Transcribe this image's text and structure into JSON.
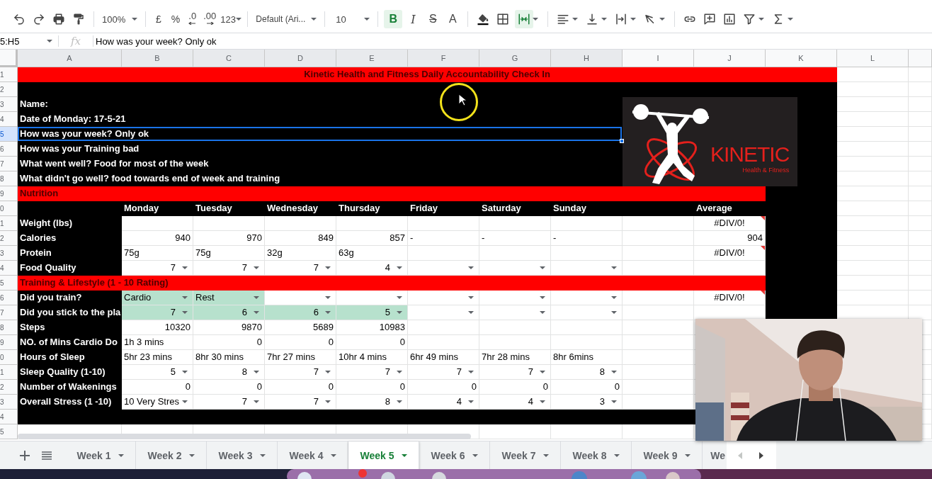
{
  "toolbar": {
    "zoom": "100%",
    "currency": "£",
    "percent": "%",
    "decimal_decrease": ".0",
    "decimal_increase": ".00",
    "number_format": "123",
    "font": "Default (Ari...",
    "font_size": "10",
    "bold": {
      "label": "B",
      "selected": true
    },
    "italic": {
      "label": "I",
      "selected": false
    },
    "strikethrough": {
      "label": "S",
      "selected": false
    },
    "text_color": {
      "label": "A"
    },
    "merge_selected": true
  },
  "formula_bar": {
    "cell_ref": "5:H5",
    "fx": "fx",
    "value": "How was your week? Only ok"
  },
  "sheet": {
    "columns": [
      {
        "label": "A",
        "selected": true
      },
      {
        "label": "B",
        "selected": true
      },
      {
        "label": "C",
        "selected": true
      },
      {
        "label": "D",
        "selected": true
      },
      {
        "label": "E",
        "selected": true
      },
      {
        "label": "F",
        "selected": true
      },
      {
        "label": "G",
        "selected": true
      },
      {
        "label": "H",
        "selected": true
      },
      {
        "label": "I",
        "selected": false
      },
      {
        "label": "J",
        "selected": false
      },
      {
        "label": "K",
        "selected": false
      },
      {
        "label": "L",
        "selected": false
      }
    ],
    "logo": {
      "title": "KINETIC",
      "subtitle": "Health & Fitness"
    },
    "rows": [
      {
        "label": "1",
        "selected": false,
        "kind": "banner",
        "title": "Kinetic Health and Fitness Daily Accountability Check In"
      },
      {
        "label": "2",
        "selected": false,
        "kind": "band"
      },
      {
        "label": "3",
        "selected": false,
        "kind": "question",
        "text": "Name:"
      },
      {
        "label": "4",
        "selected": false,
        "kind": "question",
        "text": "Date of Monday: 17-5-21"
      },
      {
        "label": "5",
        "selected": true,
        "kind": "question",
        "text": "How was your week? Only ok"
      },
      {
        "label": "6",
        "selected": false,
        "kind": "question",
        "text": "How was your Training bad"
      },
      {
        "label": "7",
        "selected": false,
        "kind": "question",
        "text": "What went well? Food for most of the week"
      },
      {
        "label": "8",
        "selected": false,
        "kind": "question",
        "text": "What didn't go well? food towards end of week and training"
      },
      {
        "label": "9",
        "selected": false,
        "kind": "section",
        "text": "Nutrition"
      },
      {
        "label": "0",
        "selected": false,
        "kind": "table",
        "cells": [
          {
            "kind": "dark"
          },
          {
            "kind": "heading",
            "text": "Monday"
          },
          {
            "kind": "heading",
            "text": "Tuesday"
          },
          {
            "kind": "heading",
            "text": "Wednesday"
          },
          {
            "kind": "heading",
            "text": "Thursday"
          },
          {
            "kind": "heading",
            "text": "Friday"
          },
          {
            "kind": "heading",
            "text": "Saturday"
          },
          {
            "kind": "heading",
            "text": "Sunday"
          },
          {
            "kind": "dark"
          },
          {
            "kind": "heading",
            "text": "Average"
          },
          {
            "kind": "dark"
          }
        ]
      },
      {
        "label": "1",
        "selected": false,
        "kind": "table",
        "cells": [
          {
            "kind": "label",
            "text": "Weight (lbs)"
          },
          {
            "kind": "blank"
          },
          {
            "kind": "blank"
          },
          {
            "kind": "blank"
          },
          {
            "kind": "blank"
          },
          {
            "kind": "blank"
          },
          {
            "kind": "blank"
          },
          {
            "kind": "blank"
          },
          {
            "kind": "blank"
          },
          {
            "kind": "error",
            "text": "#DIV/0!"
          },
          {
            "kind": "dark"
          }
        ]
      },
      {
        "label": "2",
        "selected": false,
        "kind": "table",
        "cells": [
          {
            "kind": "label",
            "text": "Calories"
          },
          {
            "kind": "number",
            "text": "940"
          },
          {
            "kind": "number",
            "text": "970"
          },
          {
            "kind": "number",
            "text": "849"
          },
          {
            "kind": "number",
            "text": "857"
          },
          {
            "kind": "text",
            "text": "-"
          },
          {
            "kind": "text",
            "text": "-"
          },
          {
            "kind": "text",
            "text": "-"
          },
          {
            "kind": "blank"
          },
          {
            "kind": "number",
            "text": "904"
          },
          {
            "kind": "dark"
          }
        ]
      },
      {
        "label": "3",
        "selected": false,
        "kind": "table",
        "cells": [
          {
            "kind": "label",
            "text": "Protein"
          },
          {
            "kind": "text",
            "text": "75g"
          },
          {
            "kind": "text",
            "text": "75g"
          },
          {
            "kind": "text",
            "text": "32g"
          },
          {
            "kind": "text",
            "text": "63g"
          },
          {
            "kind": "blank"
          },
          {
            "kind": "blank"
          },
          {
            "kind": "blank"
          },
          {
            "kind": "blank"
          },
          {
            "kind": "error",
            "text": "#DIV/0!"
          },
          {
            "kind": "dark"
          }
        ]
      },
      {
        "label": "4",
        "selected": false,
        "kind": "table",
        "cells": [
          {
            "kind": "label",
            "text": "Food Quality"
          },
          {
            "kind": "menu-number",
            "text": "7"
          },
          {
            "kind": "menu-number",
            "text": "7"
          },
          {
            "kind": "menu-number",
            "text": "7"
          },
          {
            "kind": "menu-number",
            "text": "4"
          },
          {
            "kind": "menu"
          },
          {
            "kind": "menu"
          },
          {
            "kind": "menu"
          },
          {
            "kind": "blank"
          },
          {
            "kind": "blank"
          },
          {
            "kind": "dark"
          }
        ]
      },
      {
        "label": "5",
        "selected": false,
        "kind": "section",
        "text": "Training & Lifestyle (1 - 10 Rating)"
      },
      {
        "label": "6",
        "selected": false,
        "kind": "table",
        "cells": [
          {
            "kind": "label",
            "text": "Did you train?",
            "highlighted": false
          },
          {
            "kind": "menu-text",
            "text": "Cardio",
            "highlighted": true
          },
          {
            "kind": "menu-text",
            "text": "Rest",
            "highlighted": true
          },
          {
            "kind": "menu",
            "highlighted": false
          },
          {
            "kind": "menu",
            "highlighted": false
          },
          {
            "kind": "menu",
            "highlighted": false
          },
          {
            "kind": "menu",
            "highlighted": false
          },
          {
            "kind": "menu",
            "highlighted": false
          },
          {
            "kind": "blank",
            "highlighted": false
          },
          {
            "kind": "error",
            "text": "#DIV/0!",
            "highlighted": false
          },
          {
            "kind": "dark",
            "highlighted": false
          }
        ]
      },
      {
        "label": "7",
        "selected": false,
        "kind": "table",
        "cells": [
          {
            "kind": "label",
            "text": "Did you stick to the pla",
            "highlighted": false
          },
          {
            "kind": "menu-number",
            "text": "7",
            "highlighted": true
          },
          {
            "kind": "menu-number",
            "text": "6",
            "highlighted": true
          },
          {
            "kind": "menu-number",
            "text": "6",
            "highlighted": true
          },
          {
            "kind": "menu-number",
            "text": "5",
            "highlighted": true
          },
          {
            "kind": "menu",
            "highlighted": false
          },
          {
            "kind": "menu",
            "highlighted": false
          },
          {
            "kind": "menu",
            "highlighted": false
          },
          {
            "kind": "blank",
            "highlighted": false
          },
          {
            "kind": "blank",
            "highlighted": false
          },
          {
            "kind": "dark",
            "highlighted": false
          }
        ]
      },
      {
        "label": "8",
        "selected": false,
        "kind": "table",
        "cells": [
          {
            "kind": "label",
            "text": "Steps"
          },
          {
            "kind": "number",
            "text": "10320"
          },
          {
            "kind": "number",
            "text": "9870"
          },
          {
            "kind": "number",
            "text": "5689"
          },
          {
            "kind": "number",
            "text": "10983"
          },
          {
            "kind": "blank"
          },
          {
            "kind": "blank"
          },
          {
            "kind": "blank"
          },
          {
            "kind": "blank"
          },
          {
            "kind": "blank"
          }
        ]
      },
      {
        "label": "9",
        "selected": false,
        "kind": "table",
        "cells": [
          {
            "kind": "label",
            "text": "NO. of Mins Cardio Do"
          },
          {
            "kind": "text",
            "text": "1h 3 mins"
          },
          {
            "kind": "number",
            "text": "0"
          },
          {
            "kind": "number",
            "text": "0"
          },
          {
            "kind": "number",
            "text": "0"
          },
          {
            "kind": "blank"
          },
          {
            "kind": "blank"
          },
          {
            "kind": "blank"
          },
          {
            "kind": "blank"
          },
          {
            "kind": "blank"
          }
        ]
      },
      {
        "label": "0",
        "selected": false,
        "kind": "table",
        "cells": [
          {
            "kind": "label",
            "text": "Hours of Sleep"
          },
          {
            "kind": "text",
            "text": "5hr 23 mins"
          },
          {
            "kind": "text",
            "text": "8hr 30 mins"
          },
          {
            "kind": "text",
            "text": "7hr 27 mins"
          },
          {
            "kind": "text",
            "text": "10hr 4 mins"
          },
          {
            "kind": "text",
            "text": "6hr 49 mins"
          },
          {
            "kind": "text",
            "text": "7hr 28 mins"
          },
          {
            "kind": "text",
            "text": "8hr 6mins"
          },
          {
            "kind": "blank"
          },
          {
            "kind": "blank"
          }
        ]
      },
      {
        "label": "1",
        "selected": false,
        "kind": "table",
        "cells": [
          {
            "kind": "label",
            "text": "Sleep Quality (1-10)"
          },
          {
            "kind": "menu-number",
            "text": "5"
          },
          {
            "kind": "menu-number",
            "text": "8"
          },
          {
            "kind": "menu-number",
            "text": "7"
          },
          {
            "kind": "menu-number",
            "text": "7"
          },
          {
            "kind": "menu-number",
            "text": "7"
          },
          {
            "kind": "menu-number",
            "text": "7"
          },
          {
            "kind": "menu-number",
            "text": "8"
          },
          {
            "kind": "blank"
          },
          {
            "kind": "blank"
          }
        ]
      },
      {
        "label": "2",
        "selected": false,
        "kind": "table",
        "cells": [
          {
            "kind": "label",
            "text": "Number of Wakenings"
          },
          {
            "kind": "number",
            "text": "0"
          },
          {
            "kind": "number",
            "text": "0"
          },
          {
            "kind": "number",
            "text": "0"
          },
          {
            "kind": "number",
            "text": "0"
          },
          {
            "kind": "number",
            "text": "0"
          },
          {
            "kind": "number",
            "text": "0"
          },
          {
            "kind": "number",
            "text": "0"
          },
          {
            "kind": "blank"
          },
          {
            "kind": "blank"
          }
        ]
      },
      {
        "label": "3",
        "selected": false,
        "kind": "table",
        "cells": [
          {
            "kind": "label",
            "text": "Overall Stress (1 -10)"
          },
          {
            "kind": "menu-text",
            "text": "10 Very Stres"
          },
          {
            "kind": "menu-number",
            "text": "7"
          },
          {
            "kind": "menu-number",
            "text": "7"
          },
          {
            "kind": "menu-number",
            "text": "8"
          },
          {
            "kind": "menu-number",
            "text": "4"
          },
          {
            "kind": "menu-number",
            "text": "4"
          },
          {
            "kind": "menu-number",
            "text": "3"
          },
          {
            "kind": "blank"
          },
          {
            "kind": "blank"
          }
        ]
      },
      {
        "label": "4",
        "selected": false,
        "kind": "band"
      },
      {
        "label": "5",
        "selected": false,
        "kind": "empty"
      }
    ]
  },
  "sheet_tabs": [
    {
      "label": "Week 1",
      "selected": false,
      "kind": "full"
    },
    {
      "label": "Week 2",
      "selected": false,
      "kind": "full"
    },
    {
      "label": "Week 3",
      "selected": false,
      "kind": "full"
    },
    {
      "label": "Week 4",
      "selected": false,
      "kind": "full"
    },
    {
      "label": "Week 5",
      "selected": true,
      "kind": "full"
    },
    {
      "label": "Week 6",
      "selected": false,
      "kind": "full"
    },
    {
      "label": "Week 7",
      "selected": false,
      "kind": "full"
    },
    {
      "label": "Week 8",
      "selected": false,
      "kind": "full"
    },
    {
      "label": "Week 9",
      "selected": false,
      "kind": "full"
    },
    {
      "label": "We",
      "selected": false,
      "kind": "partial"
    }
  ]
}
